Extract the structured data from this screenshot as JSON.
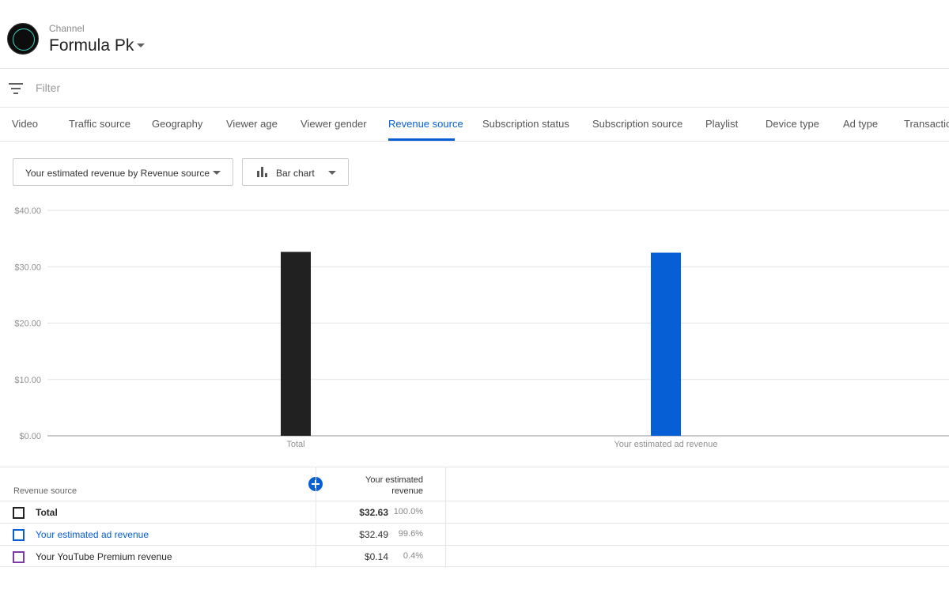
{
  "header": {
    "channel_caption": "Channel",
    "channel_name": "Formula Pk"
  },
  "filter": {
    "placeholder": "Filter"
  },
  "tabs": [
    {
      "label": "Video"
    },
    {
      "label": "Traffic source"
    },
    {
      "label": "Geography"
    },
    {
      "label": "Viewer age"
    },
    {
      "label": "Viewer gender"
    },
    {
      "label": "Revenue source",
      "active": true
    },
    {
      "label": "Subscription status"
    },
    {
      "label": "Subscription source"
    },
    {
      "label": "Playlist"
    },
    {
      "label": "Device type"
    },
    {
      "label": "Ad type"
    },
    {
      "label": "Transaction"
    }
  ],
  "controls": {
    "metric_dropdown": "Your estimated revenue by Revenue source",
    "chart_type_dropdown": "Bar chart"
  },
  "chart_data": {
    "type": "bar",
    "categories": [
      "Total",
      "Your estimated ad revenue"
    ],
    "values": [
      32.63,
      32.49
    ],
    "colors": [
      "#212121",
      "#065fd4"
    ],
    "ylim": [
      0,
      40
    ],
    "yticks": [
      0,
      10,
      20,
      30,
      40
    ],
    "ytick_labels": [
      "$0.00",
      "$10.00",
      "$20.00",
      "$30.00",
      "$40.00"
    ],
    "grid": true
  },
  "table": {
    "header_source": "Revenue source",
    "header_revenue_line1": "Your estimated",
    "header_revenue_line2": "revenue",
    "rows": [
      {
        "name": "Total",
        "value": "$32.63",
        "percent": "100.0%",
        "checkbox_color": "#212121",
        "name_color": "#282828",
        "bold": true
      },
      {
        "name": "Your estimated ad revenue",
        "value": "$32.49",
        "percent": "99.6%",
        "checkbox_color": "#065fd4",
        "name_color": "#065fd4",
        "bold": false
      },
      {
        "name": "Your YouTube Premium revenue",
        "value": "$0.14",
        "percent": "0.4%",
        "checkbox_color": "#7b3aa6",
        "name_color": "#282828",
        "bold": false
      }
    ]
  },
  "colors": {
    "accent": "#065fd4"
  }
}
